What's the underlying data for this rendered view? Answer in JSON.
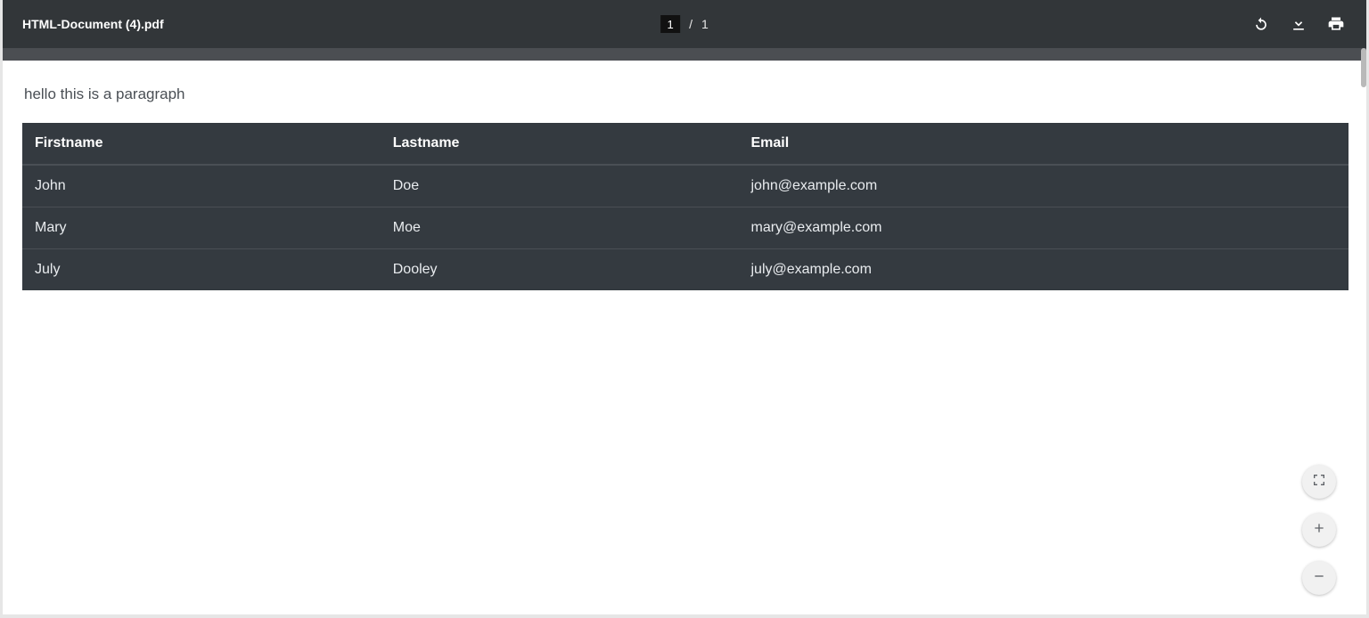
{
  "toolbar": {
    "title": "HTML-Document (4).pdf",
    "page_current": "1",
    "page_sep": "/",
    "page_total": "1"
  },
  "document": {
    "paragraph": "hello this is a paragraph",
    "table": {
      "headers": [
        "Firstname",
        "Lastname",
        "Email"
      ],
      "rows": [
        {
          "firstname": "John",
          "lastname": "Doe",
          "email": "john@example.com"
        },
        {
          "firstname": "Mary",
          "lastname": "Moe",
          "email": "mary@example.com"
        },
        {
          "firstname": "July",
          "lastname": "Dooley",
          "email": "july@example.com"
        }
      ]
    }
  }
}
